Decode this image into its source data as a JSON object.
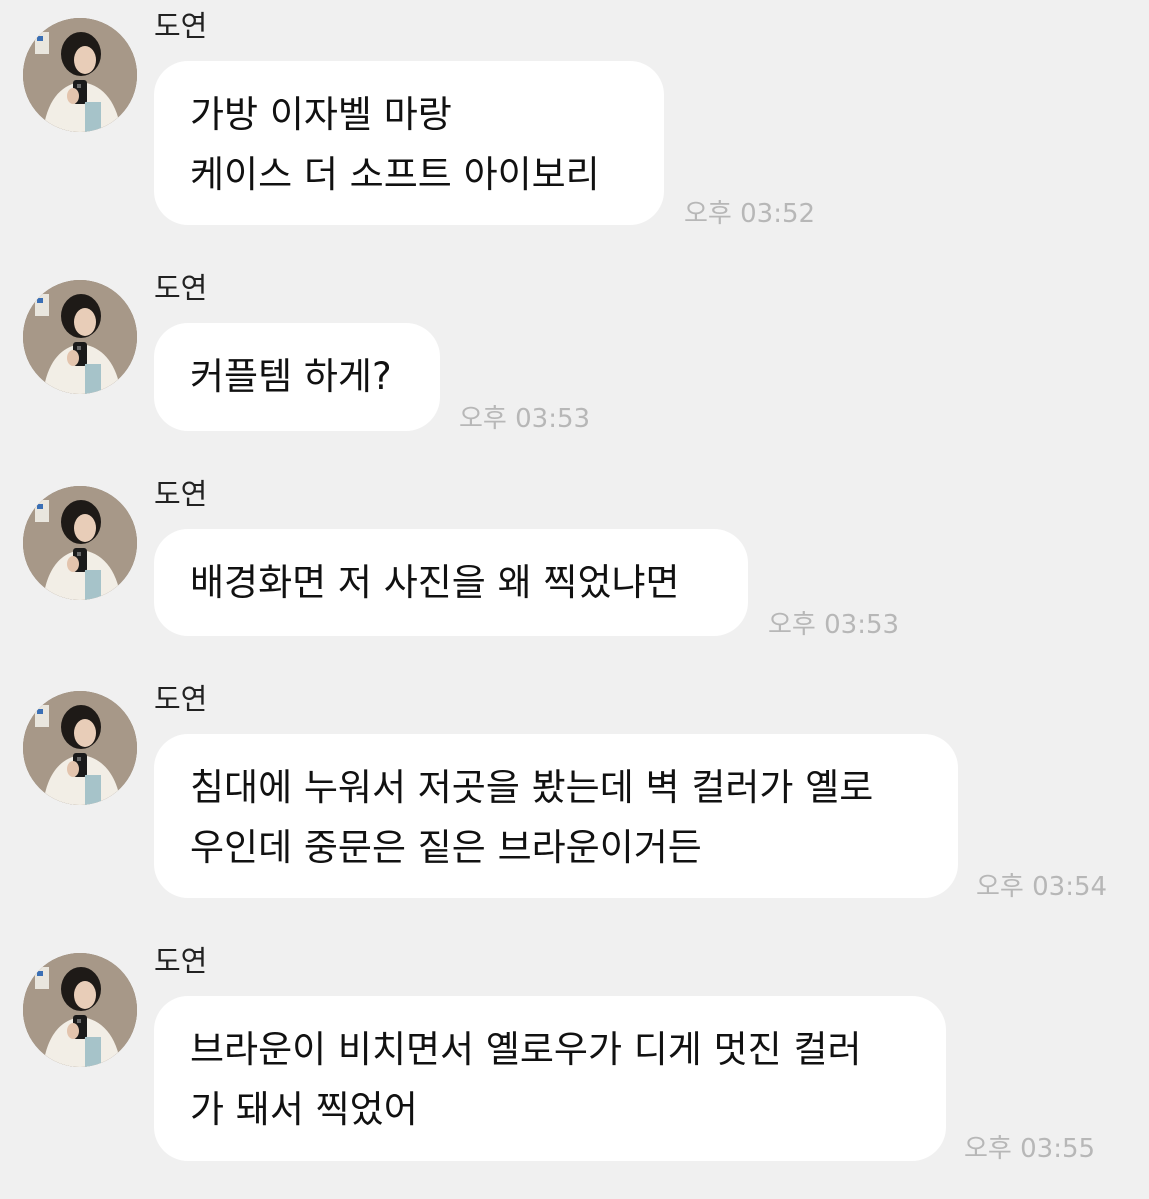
{
  "chat": {
    "messages": [
      {
        "sender": "도연",
        "text": "가방 이자벨 마랑\n케이스 더 소프트 아이보리",
        "time": "오후 03:52"
      },
      {
        "sender": "도연",
        "text": "커플템 하게?",
        "time": "오후 03:53"
      },
      {
        "sender": "도연",
        "text": "배경화면 저 사진을 왜 찍었냐면",
        "time": "오후 03:53"
      },
      {
        "sender": "도연",
        "text": "침대에 누워서 저곳을 봤는데 벽 컬러가 옐로\n우인데 중문은 짙은 브라운이거든",
        "time": "오후 03:54"
      },
      {
        "sender": "도연",
        "text": "브라운이 비치면서 옐로우가 디게 멋진 컬러\n가 돼서 찍었어",
        "time": "오후 03:55"
      }
    ]
  }
}
